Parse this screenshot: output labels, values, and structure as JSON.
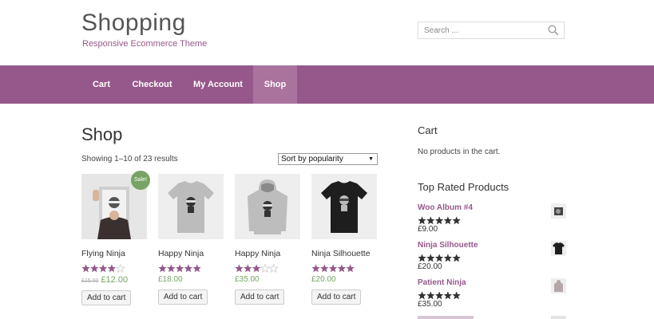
{
  "header": {
    "site_title": "Shopping",
    "tagline": "Responsive Ecommerce Theme",
    "search_placeholder": "Search ..."
  },
  "nav": {
    "items": [
      {
        "label": "Cart"
      },
      {
        "label": "Checkout"
      },
      {
        "label": "My Account"
      },
      {
        "label": "Shop",
        "active": true
      }
    ]
  },
  "main": {
    "title": "Shop",
    "result_count": "Showing 1–10 of 23 results",
    "sort_selected": "Sort by popularity",
    "sale_badge": "Sale!",
    "add_to_cart_label": "Add to cart",
    "products": [
      {
        "title": "Flying Ninja",
        "rating": 4,
        "old_price": "£15.00",
        "price": "£12.00",
        "image": "poster"
      },
      {
        "title": "Happy Ninja",
        "rating": 5,
        "price": "£18.00",
        "image": "grey-tshirt"
      },
      {
        "title": "Happy Ninja",
        "rating": 3,
        "price": "£35.00",
        "image": "grey-hoodie"
      },
      {
        "title": "Ninja Silhouette",
        "rating": 5,
        "price": "£20.00",
        "image": "black-tshirt"
      }
    ]
  },
  "sidebar": {
    "cart": {
      "title": "Cart",
      "empty_text": "No products in the cart."
    },
    "top_rated": {
      "title": "Top Rated Products",
      "items": [
        {
          "name": "Woo Album #4",
          "rating": 5,
          "price": "£9.00",
          "thumb": "album"
        },
        {
          "name": "Ninja Silhouette",
          "rating": 5,
          "price": "£20.00",
          "thumb": "black-tshirt"
        },
        {
          "name": "Patient Ninja",
          "rating": 5,
          "price": "£35.00",
          "thumb": "hoodie"
        }
      ]
    }
  },
  "colors": {
    "brand": "#96588a",
    "nav_active": "#a9739e",
    "price": "#77a464",
    "sale": "#77a464"
  }
}
